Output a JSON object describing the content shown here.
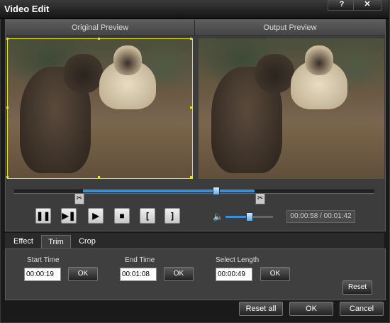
{
  "window": {
    "title": "Video Edit"
  },
  "titlebar": {
    "help_label": "?",
    "close_label": "✕"
  },
  "preview": {
    "original_label": "Original Preview",
    "output_label": "Output Preview"
  },
  "timeline": {
    "position_fraction": 0.56
  },
  "playback": {
    "play_pause": "❚❚",
    "next_frame": "▶❚",
    "play_clip": "▶",
    "stop": "■",
    "mark_in": "[",
    "mark_out": "]"
  },
  "volume": {
    "level_fraction": 0.5
  },
  "time_display": "00:00:58 / 00:01:42",
  "tabs": [
    {
      "label": "Effect",
      "active": false
    },
    {
      "label": "Trim",
      "active": true
    },
    {
      "label": "Crop",
      "active": false
    }
  ],
  "trim": {
    "start_time_label": "Start Time",
    "start_time_value": "00:00:19",
    "end_time_label": "End Time",
    "end_time_value": "00:01:08",
    "select_length_label": "Select Length",
    "select_length_value": "00:00:49",
    "ok_label": "OK",
    "reset_label": "Reset"
  },
  "footer": {
    "reset_all_label": "Reset all",
    "ok_label": "OK",
    "cancel_label": "Cancel"
  },
  "colors": {
    "accent": "#3a8fd8",
    "selection": "#e6e60a"
  },
  "icons": {
    "volume": "speaker-icon",
    "scissor": "scissor-icon"
  }
}
